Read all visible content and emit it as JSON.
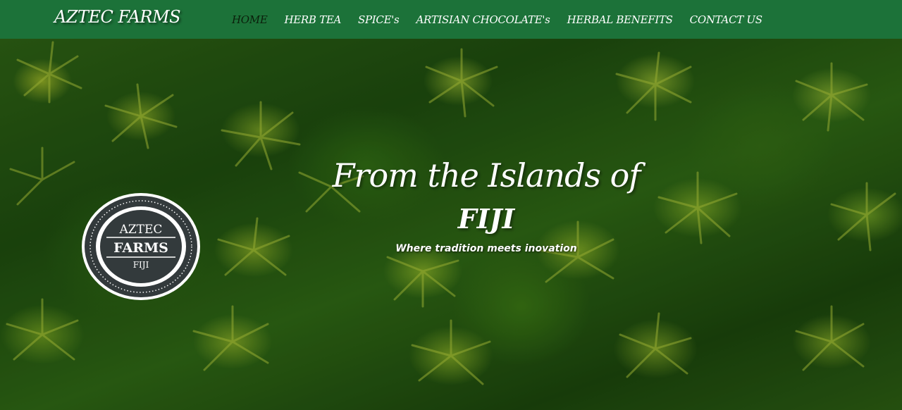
{
  "header": {
    "brand": "AZTEC FARMS",
    "nav": [
      {
        "label": "HOME",
        "active": true
      },
      {
        "label": "HERB TEA",
        "active": false
      },
      {
        "label": "SPICE's",
        "active": false
      },
      {
        "label": "ARTISIAN CHOCOLATE's",
        "active": false
      },
      {
        "label": "HERBAL BENEFITS",
        "active": false
      },
      {
        "label": "CONTACT US",
        "active": false
      }
    ]
  },
  "hero": {
    "title": "From the Islands of",
    "country": "FIJI",
    "tagline": "Where tradition meets inovation",
    "background": "aerial-palm-forest-image"
  },
  "logo": {
    "line1": "AZTEC",
    "line2": "FARMS",
    "line3": "FIJI",
    "icon": "aztec-farms-seal-logo"
  },
  "colors": {
    "navbar": "#1c7239",
    "nav_active": "#0b1f0b",
    "text": "#ffffff",
    "seal_dark": "#333a3c",
    "seal_light": "#ffffff"
  }
}
